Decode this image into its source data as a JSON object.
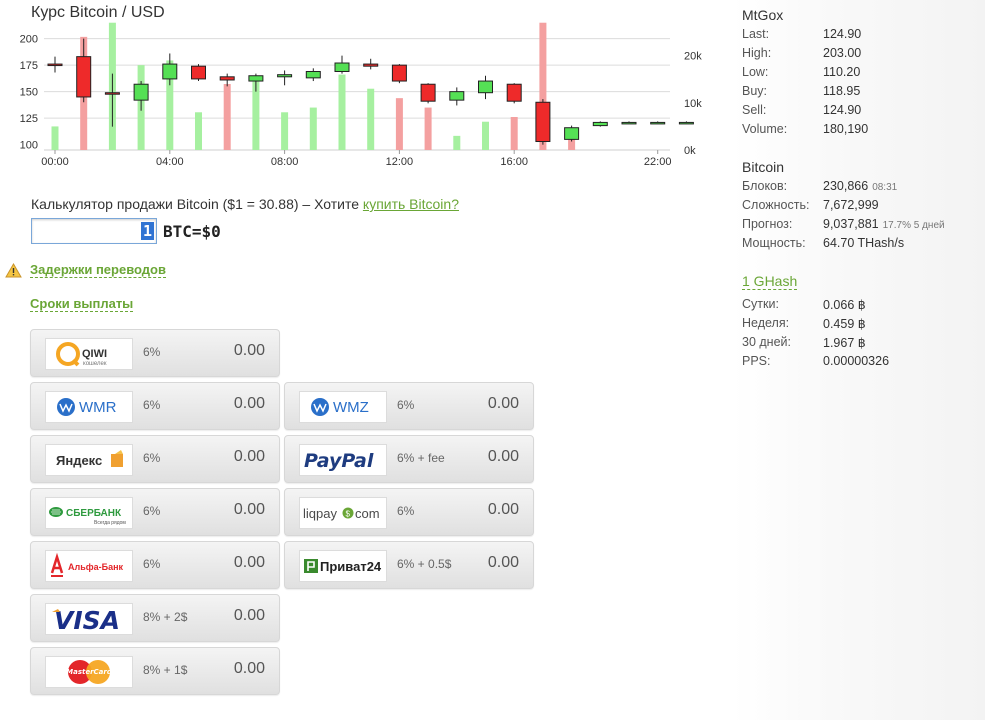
{
  "chart": {
    "title": "Курс Bitcoin / USD"
  },
  "chart_data": {
    "type": "candlestick",
    "title": "Курс Bitcoin / USD",
    "x_ticks": [
      "00:00",
      "04:00",
      "08:00",
      "12:00",
      "16:00",
      "22:00"
    ],
    "y_left_ticks": [
      "200",
      "175",
      "150",
      "125",
      "100"
    ],
    "y_right_ticks": [
      "20k",
      "10k",
      "0k"
    ],
    "ylim_price": [
      95,
      210
    ],
    "ylim_volume": [
      0,
      28000
    ],
    "candles": [
      {
        "h": 0,
        "open": 176,
        "close": 175,
        "high": 183,
        "low": 168,
        "up": false,
        "vol": 5000,
        "volUp": true
      },
      {
        "h": 1,
        "open": 183,
        "close": 145,
        "high": 200,
        "low": 140,
        "up": false,
        "vol": 24000,
        "volUp": false
      },
      {
        "h": 2,
        "open": 149,
        "close": 148,
        "high": 167,
        "low": 117,
        "up": false,
        "vol": 27000,
        "volUp": true
      },
      {
        "h": 3,
        "open": 142,
        "close": 157,
        "high": 160,
        "low": 132,
        "up": true,
        "vol": 18000,
        "volUp": true
      },
      {
        "h": 4,
        "open": 162,
        "close": 176,
        "high": 186,
        "low": 156,
        "up": true,
        "vol": 19000,
        "volUp": true
      },
      {
        "h": 5,
        "open": 174,
        "close": 162,
        "high": 176,
        "low": 160,
        "up": false,
        "vol": 8000,
        "volUp": true
      },
      {
        "h": 6,
        "open": 164,
        "close": 161,
        "high": 167,
        "low": 155,
        "up": false,
        "vol": 14000,
        "volUp": false
      },
      {
        "h": 7,
        "open": 160,
        "close": 165,
        "high": 167,
        "low": 150,
        "up": true,
        "vol": 15000,
        "volUp": true
      },
      {
        "h": 8,
        "open": 164,
        "close": 166,
        "high": 170,
        "low": 156,
        "up": true,
        "vol": 8000,
        "volUp": true
      },
      {
        "h": 9,
        "open": 163,
        "close": 169,
        "high": 172,
        "low": 160,
        "up": true,
        "vol": 9000,
        "volUp": true
      },
      {
        "h": 10,
        "open": 169,
        "close": 177,
        "high": 184,
        "low": 167,
        "up": true,
        "vol": 16000,
        "volUp": true
      },
      {
        "h": 11,
        "open": 176,
        "close": 174,
        "high": 181,
        "low": 171,
        "up": false,
        "vol": 13000,
        "volUp": true
      },
      {
        "h": 12,
        "open": 175,
        "close": 160,
        "high": 176,
        "low": 158,
        "up": false,
        "vol": 11000,
        "volUp": false
      },
      {
        "h": 13,
        "open": 157,
        "close": 141,
        "high": 158,
        "low": 139,
        "up": false,
        "vol": 9000,
        "volUp": false
      },
      {
        "h": 14,
        "open": 142,
        "close": 150,
        "high": 154,
        "low": 137,
        "up": true,
        "vol": 3000,
        "volUp": true
      },
      {
        "h": 15,
        "open": 149,
        "close": 160,
        "high": 165,
        "low": 143,
        "up": true,
        "vol": 6000,
        "volUp": true
      },
      {
        "h": 16,
        "open": 157,
        "close": 141,
        "high": 158,
        "low": 139,
        "up": false,
        "vol": 7000,
        "volUp": false
      },
      {
        "h": 17,
        "open": 140,
        "close": 103,
        "high": 143,
        "low": 100,
        "up": false,
        "vol": 27000,
        "volUp": false
      },
      {
        "h": 18,
        "open": 105,
        "close": 116,
        "high": 118,
        "low": 103,
        "up": true,
        "vol": 2500,
        "volUp": false
      },
      {
        "h": 19,
        "open": 118,
        "close": 121,
        "high": 122,
        "low": 117,
        "up": true,
        "vol": 0,
        "volUp": true
      },
      {
        "h": 20,
        "open": 121,
        "close": 121,
        "high": 122,
        "low": 120,
        "up": true,
        "vol": 0,
        "volUp": true
      },
      {
        "h": 21,
        "open": 121,
        "close": 121,
        "high": 122,
        "low": 120,
        "up": true,
        "vol": 0,
        "volUp": true
      },
      {
        "h": 22,
        "open": 121,
        "close": 121,
        "high": 122,
        "low": 120,
        "up": true,
        "vol": 0,
        "volUp": true
      }
    ]
  },
  "calc": {
    "text": "Калькулятор продажи Bitcoin ($1 = 30.88) – Хотите ",
    "link": "купить Bitcoin?",
    "input_value": "1",
    "result": "BTC=$0"
  },
  "links": {
    "delays": "Задержки переводов",
    "terms": "Сроки выплаты"
  },
  "tiles": [
    {
      "id": "qiwi",
      "logo": "QIWI",
      "logo_sub": "кошелек",
      "fee": "6%",
      "amount": "0.00"
    },
    {
      "id": "wmr",
      "logo": "WMR",
      "fee": "6%",
      "amount": "0.00"
    },
    {
      "id": "wmz",
      "logo": "WMZ",
      "fee": "6%",
      "amount": "0.00"
    },
    {
      "id": "yandex",
      "logo": "Яндекс",
      "fee": "6%",
      "amount": "0.00"
    },
    {
      "id": "paypal",
      "logo": "PayPal",
      "fee": "6% + fee",
      "amount": "0.00"
    },
    {
      "id": "sberbank",
      "logo": "СБЕРБАНК",
      "logo_sub": "Всегда рядом",
      "fee": "6%",
      "amount": "0.00"
    },
    {
      "id": "liqpay",
      "logo": "liqpay",
      "logo_sub": "com",
      "fee": "6%",
      "amount": "0.00"
    },
    {
      "id": "alfa",
      "logo": "Альфа-Банк",
      "fee": "6%",
      "amount": "0.00"
    },
    {
      "id": "privat",
      "logo": "Приват24",
      "fee": "6% + 0.5$",
      "amount": "0.00"
    },
    {
      "id": "visa",
      "logo": "VISA",
      "fee": "8% + 2$",
      "amount": "0.00"
    },
    {
      "id": "mastercard",
      "logo": "MasterCard",
      "fee": "8% + 1$",
      "amount": "0.00"
    }
  ],
  "mtgox": {
    "title": "MtGox",
    "rows": [
      {
        "k": "Last:",
        "v": "124.90"
      },
      {
        "k": "High:",
        "v": "203.00"
      },
      {
        "k": "Low:",
        "v": "110.20"
      },
      {
        "k": "Buy:",
        "v": "118.95"
      },
      {
        "k": "Sell:",
        "v": "124.90"
      },
      {
        "k": "Volume:",
        "v": "180,190"
      }
    ]
  },
  "bitcoin": {
    "title": "Bitcoin",
    "rows": [
      {
        "k": "Блоков:",
        "v": "230,866",
        "s": "08:31"
      },
      {
        "k": "Сложность:",
        "v": "7,672,999",
        "s": ""
      },
      {
        "k": "Прогноз:",
        "v": "9,037,881",
        "s": "17.7% 5 дней"
      },
      {
        "k": "Мощность:",
        "v": "64.70 THash/s",
        "s": ""
      }
    ]
  },
  "ghash": {
    "title": "1 GHash",
    "rows": [
      {
        "k": "Сутки:",
        "v": "0.066 ฿"
      },
      {
        "k": "Неделя:",
        "v": "0.459 ฿"
      },
      {
        "k": "30 дней:",
        "v": "1.967 ฿"
      },
      {
        "k": "PPS:",
        "v": "0.00000326"
      }
    ]
  },
  "colors": {
    "up": "#55e055",
    "down": "#ee2a2a",
    "vol_up": "#a6f0a0",
    "vol_down": "#f4a0a0",
    "link": "#6aa636"
  }
}
